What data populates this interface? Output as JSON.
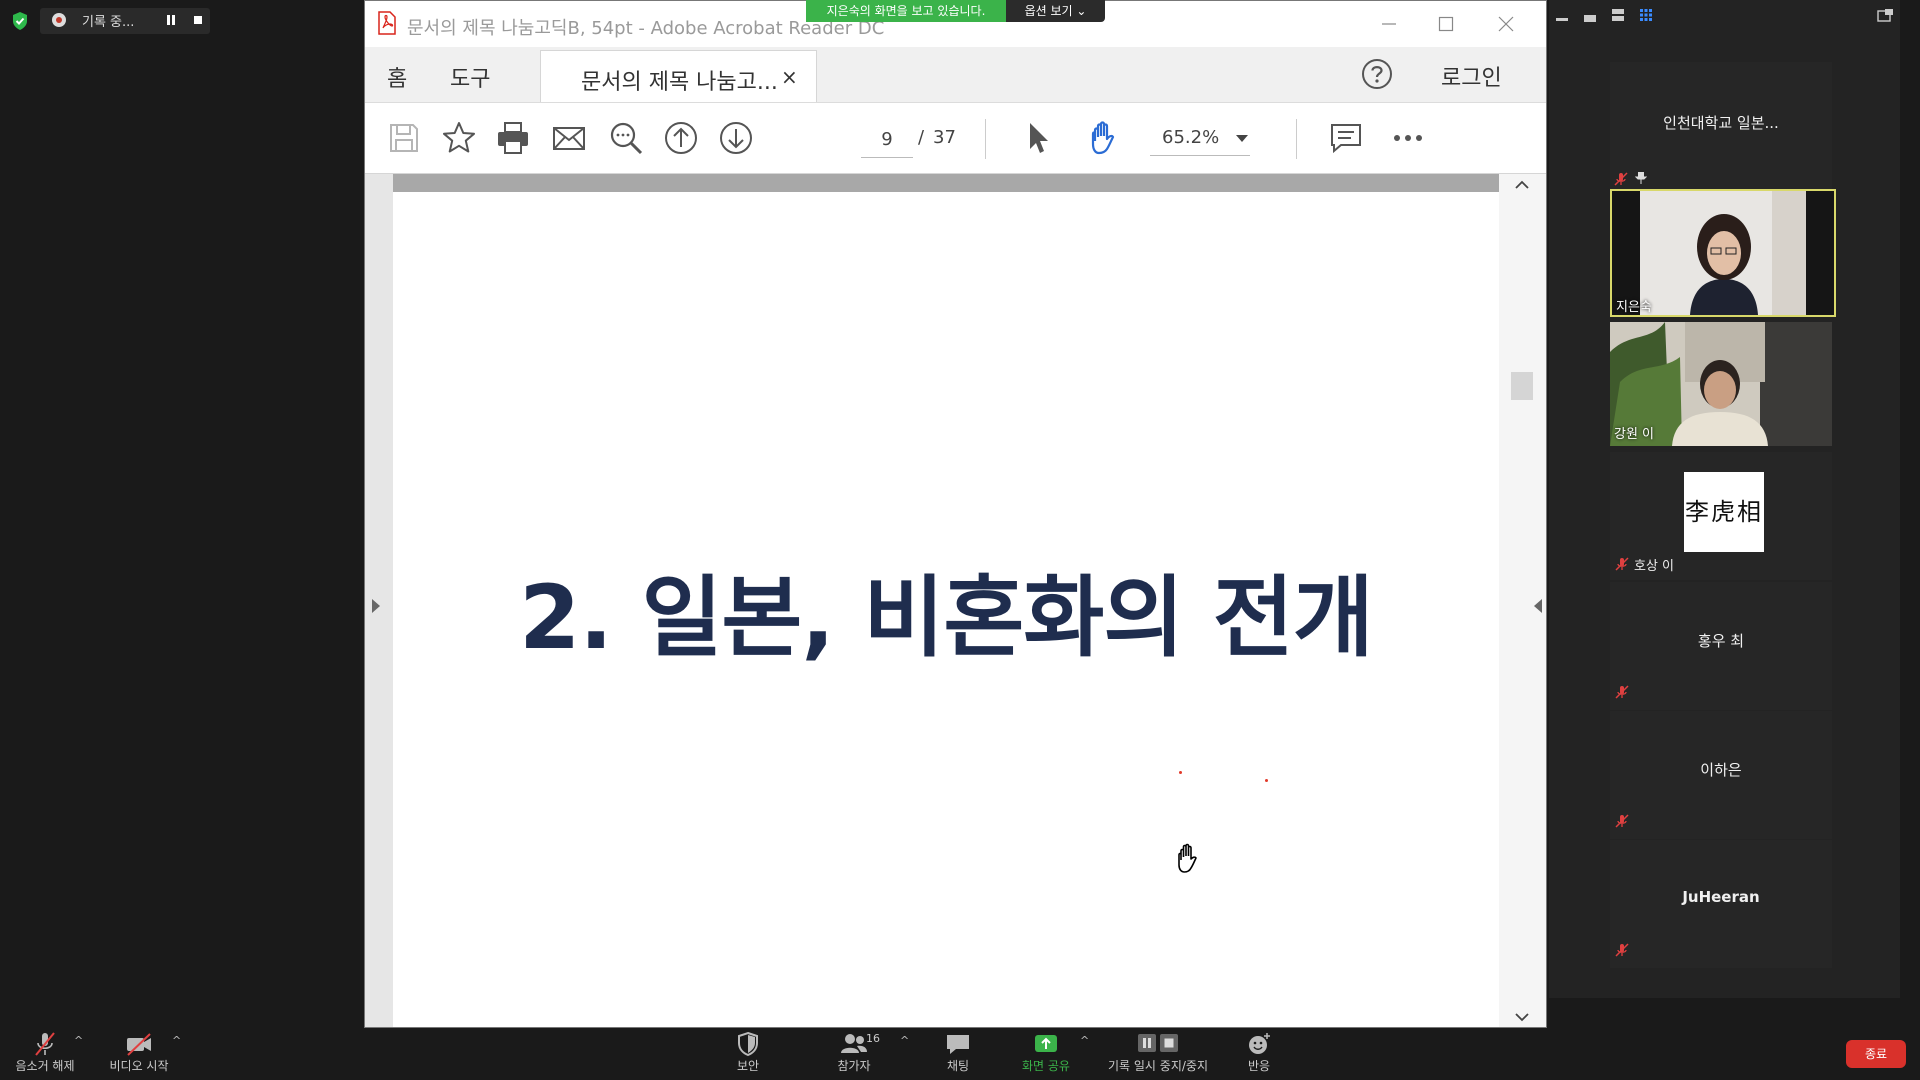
{
  "recording": {
    "label": "기록 중..."
  },
  "share_banner": {
    "text": "지은숙의 화면을 보고 있습니다.",
    "options_label": "옵션 보기 ⌄"
  },
  "acrobat": {
    "title": "문서의 제목 나눔고딕B, 54pt - Adobe Acrobat Reader DC",
    "menu": {
      "home": "홈",
      "tools": "도구",
      "tab_label": "문서의 제목 나눔고...",
      "tab_close": "×",
      "login": "로그인"
    },
    "page": {
      "current": "9",
      "separator": "/",
      "total": "37"
    },
    "zoom": "65.2%"
  },
  "slide": {
    "title": "2. 일본, 비혼화의 전개"
  },
  "participants": {
    "org_tile": "인천대학교 일본...",
    "tiles": [
      {
        "name": "지은숙"
      },
      {
        "name": "강원 이"
      },
      {
        "name": "호상 이",
        "image_text": "李虎相"
      },
      {
        "name": "홍우 최"
      },
      {
        "name": "이하은"
      },
      {
        "name": "JuHeeran"
      }
    ]
  },
  "bottom_bar": {
    "unmute": "음소거 해제",
    "start_video": "비디오 시작",
    "security": "보안",
    "participants": "참가자",
    "participants_count": "16",
    "chat": "채팅",
    "share_screen": "화면 공유",
    "pause_stop_recording": "기록 일시 중지/중지",
    "reactions": "반응",
    "end": "종료"
  },
  "colors": {
    "share_green": "#3bb34a",
    "active_border": "#d8d86a",
    "end_red": "#d9312b",
    "slide_title": "#1f2d4e",
    "hand_blue": "#2b6cd4"
  }
}
